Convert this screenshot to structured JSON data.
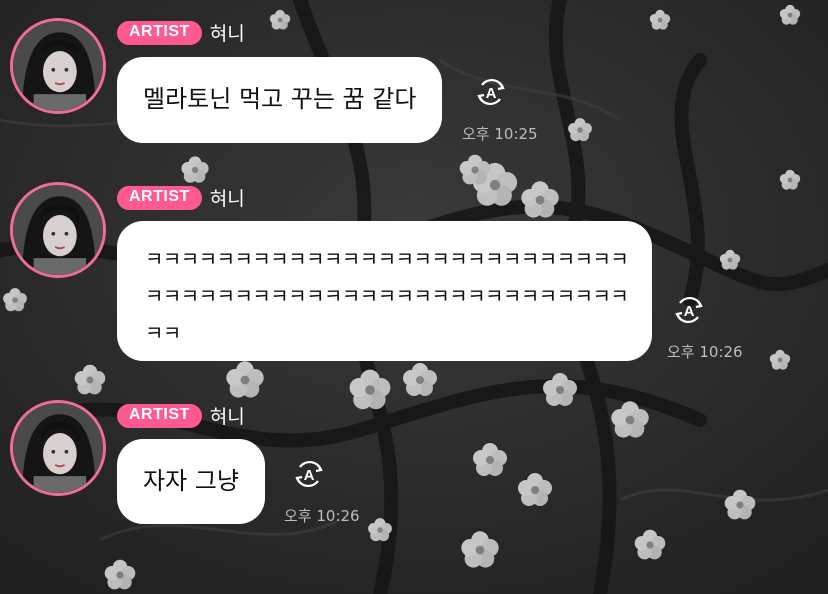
{
  "messages": [
    {
      "badge": "ARTIST",
      "author": "혀니",
      "lines": [
        "멜라토닌 먹고 꾸는 꿈 같다"
      ],
      "time": "오후 10:25",
      "translate_icon": "translate-icon"
    },
    {
      "badge": "ARTIST",
      "author": "혀니",
      "lines": [
        "ㅋㅋㅋㅋㅋㅋㅋㅋㅋㅋㅋㅋㅋㅋㅋㅋㅋㅋㅋㅋㅋㅋㅋㅋㅋㅋㅋ",
        "ㅋㅋㅋㅋㅋㅋㅋㅋㅋㅋㅋㅋㅋㅋㅋㅋㅋㅋㅋㅋㅋㅋㅋㅋㅋㅋㅋ",
        "ㅋㅋ"
      ],
      "time": "오후 10:26",
      "translate_icon": "translate-icon"
    },
    {
      "badge": "ARTIST",
      "author": "혀니",
      "lines": [
        "자자 그냥"
      ],
      "time": "오후 10:26",
      "translate_icon": "translate-icon"
    }
  ],
  "colors": {
    "badge": "#ff5a8f",
    "avatar_ring": "#f06c9e",
    "bubble": "#ffffff",
    "timestamp": "#bdbdbd"
  }
}
